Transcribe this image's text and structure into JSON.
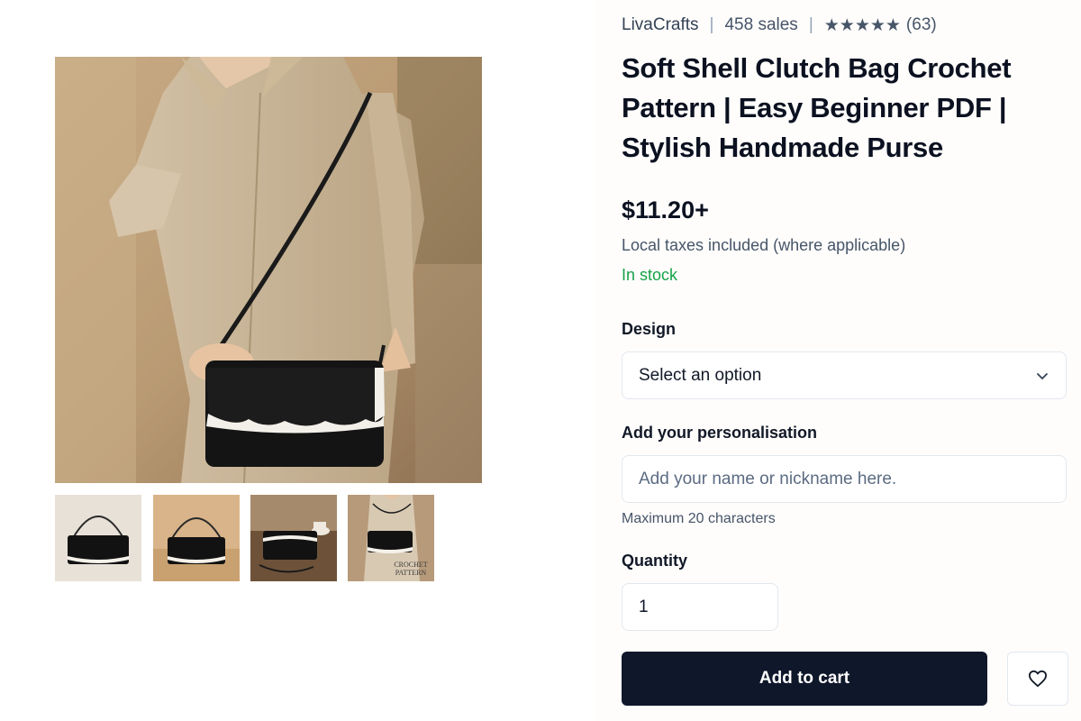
{
  "product": {
    "shop_name": "LivaCrafts",
    "sales": "458 sales",
    "rating_stars": "★★★★★",
    "review_count": "(63)",
    "title": "Soft Shell Clutch Bag Crochet Pattern | Easy Beginner PDF | Stylish Handmade Purse",
    "price": "$11.20+",
    "taxes_note": "Local taxes included (where applicable)",
    "stock_status": "In stock"
  },
  "gallery": {
    "thumb_4_caption_line1": "CROCHET",
    "thumb_4_caption_line2": "PATTERN"
  },
  "form": {
    "design_label": "Design",
    "design_selected": "Select an option",
    "personalisation_label": "Add your personalisation",
    "personalisation_placeholder": "Add your name or nickname here.",
    "personalisation_hint": "Maximum 20 characters",
    "quantity_label": "Quantity",
    "quantity_value": "1",
    "add_to_cart": "Add to cart"
  },
  "icons": {
    "design_dropdown": "chevron-down-icon",
    "favorite": "heart-icon"
  },
  "colors": {
    "primary_button": "#0f172a",
    "stock_green": "#16a34a",
    "muted_text": "#475569"
  }
}
